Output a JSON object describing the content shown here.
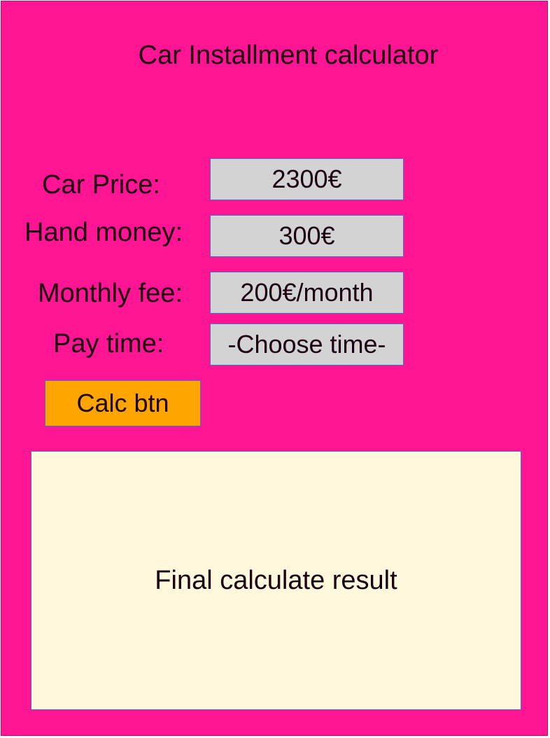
{
  "header": {
    "title": "Car Installment calculator"
  },
  "form": {
    "car_price": {
      "label": "Car Price:",
      "value": "2300€"
    },
    "hand_money": {
      "label": "Hand money:",
      "value": "300€"
    },
    "monthly_fee": {
      "label": "Monthly fee:",
      "value": "200€/month"
    },
    "pay_time": {
      "label": "Pay time:",
      "selected": "-Choose time-"
    }
  },
  "actions": {
    "calc_label": "Calc btn"
  },
  "result": {
    "text": "Final calculate result"
  },
  "colors": {
    "background": "#ff1493",
    "field": "#d3d3d3",
    "button": "#ffa500",
    "result_box": "#fff8dc",
    "border": "#4472c4"
  }
}
